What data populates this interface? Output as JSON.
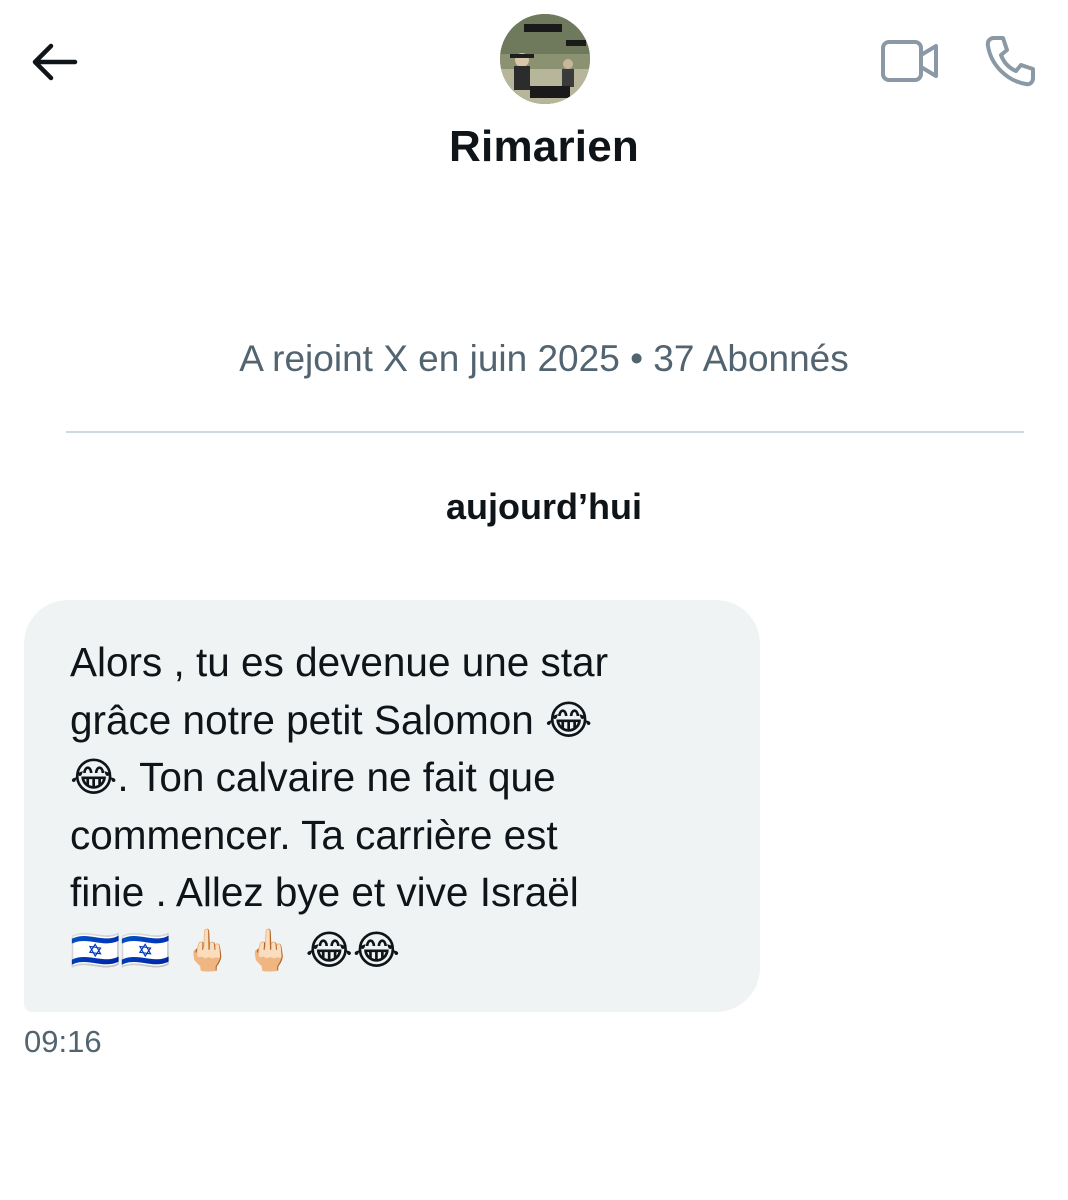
{
  "header": {
    "back_icon": "arrow-left-icon",
    "avatar_alt": "profile picture",
    "video_call_icon": "video-camera-icon",
    "phone_call_icon": "phone-icon",
    "contact_name": "Rimarien"
  },
  "profile": {
    "meta": "A rejoint X en juin 2025 • 37 Abonnés"
  },
  "conversation": {
    "date_separator": "aujourd’hui",
    "messages": [
      {
        "text": "Alors , tu es devenue une  star\ngrâce  notre petit Salomon 😂\n😂. Ton calvaire ne fait que\ncommencer. Ta carrière est\nfinie . Allez bye et vive Israël\n🇮🇱🇮🇱 🖕🏻 🖕🏻 😂😂",
        "time": "09:16",
        "direction": "incoming"
      }
    ]
  },
  "colors": {
    "text_primary": "#0f1419",
    "text_secondary": "#536471",
    "bubble_incoming": "#eff3f4",
    "divider": "#cfd9de",
    "icon_muted": "#8b98a5"
  }
}
